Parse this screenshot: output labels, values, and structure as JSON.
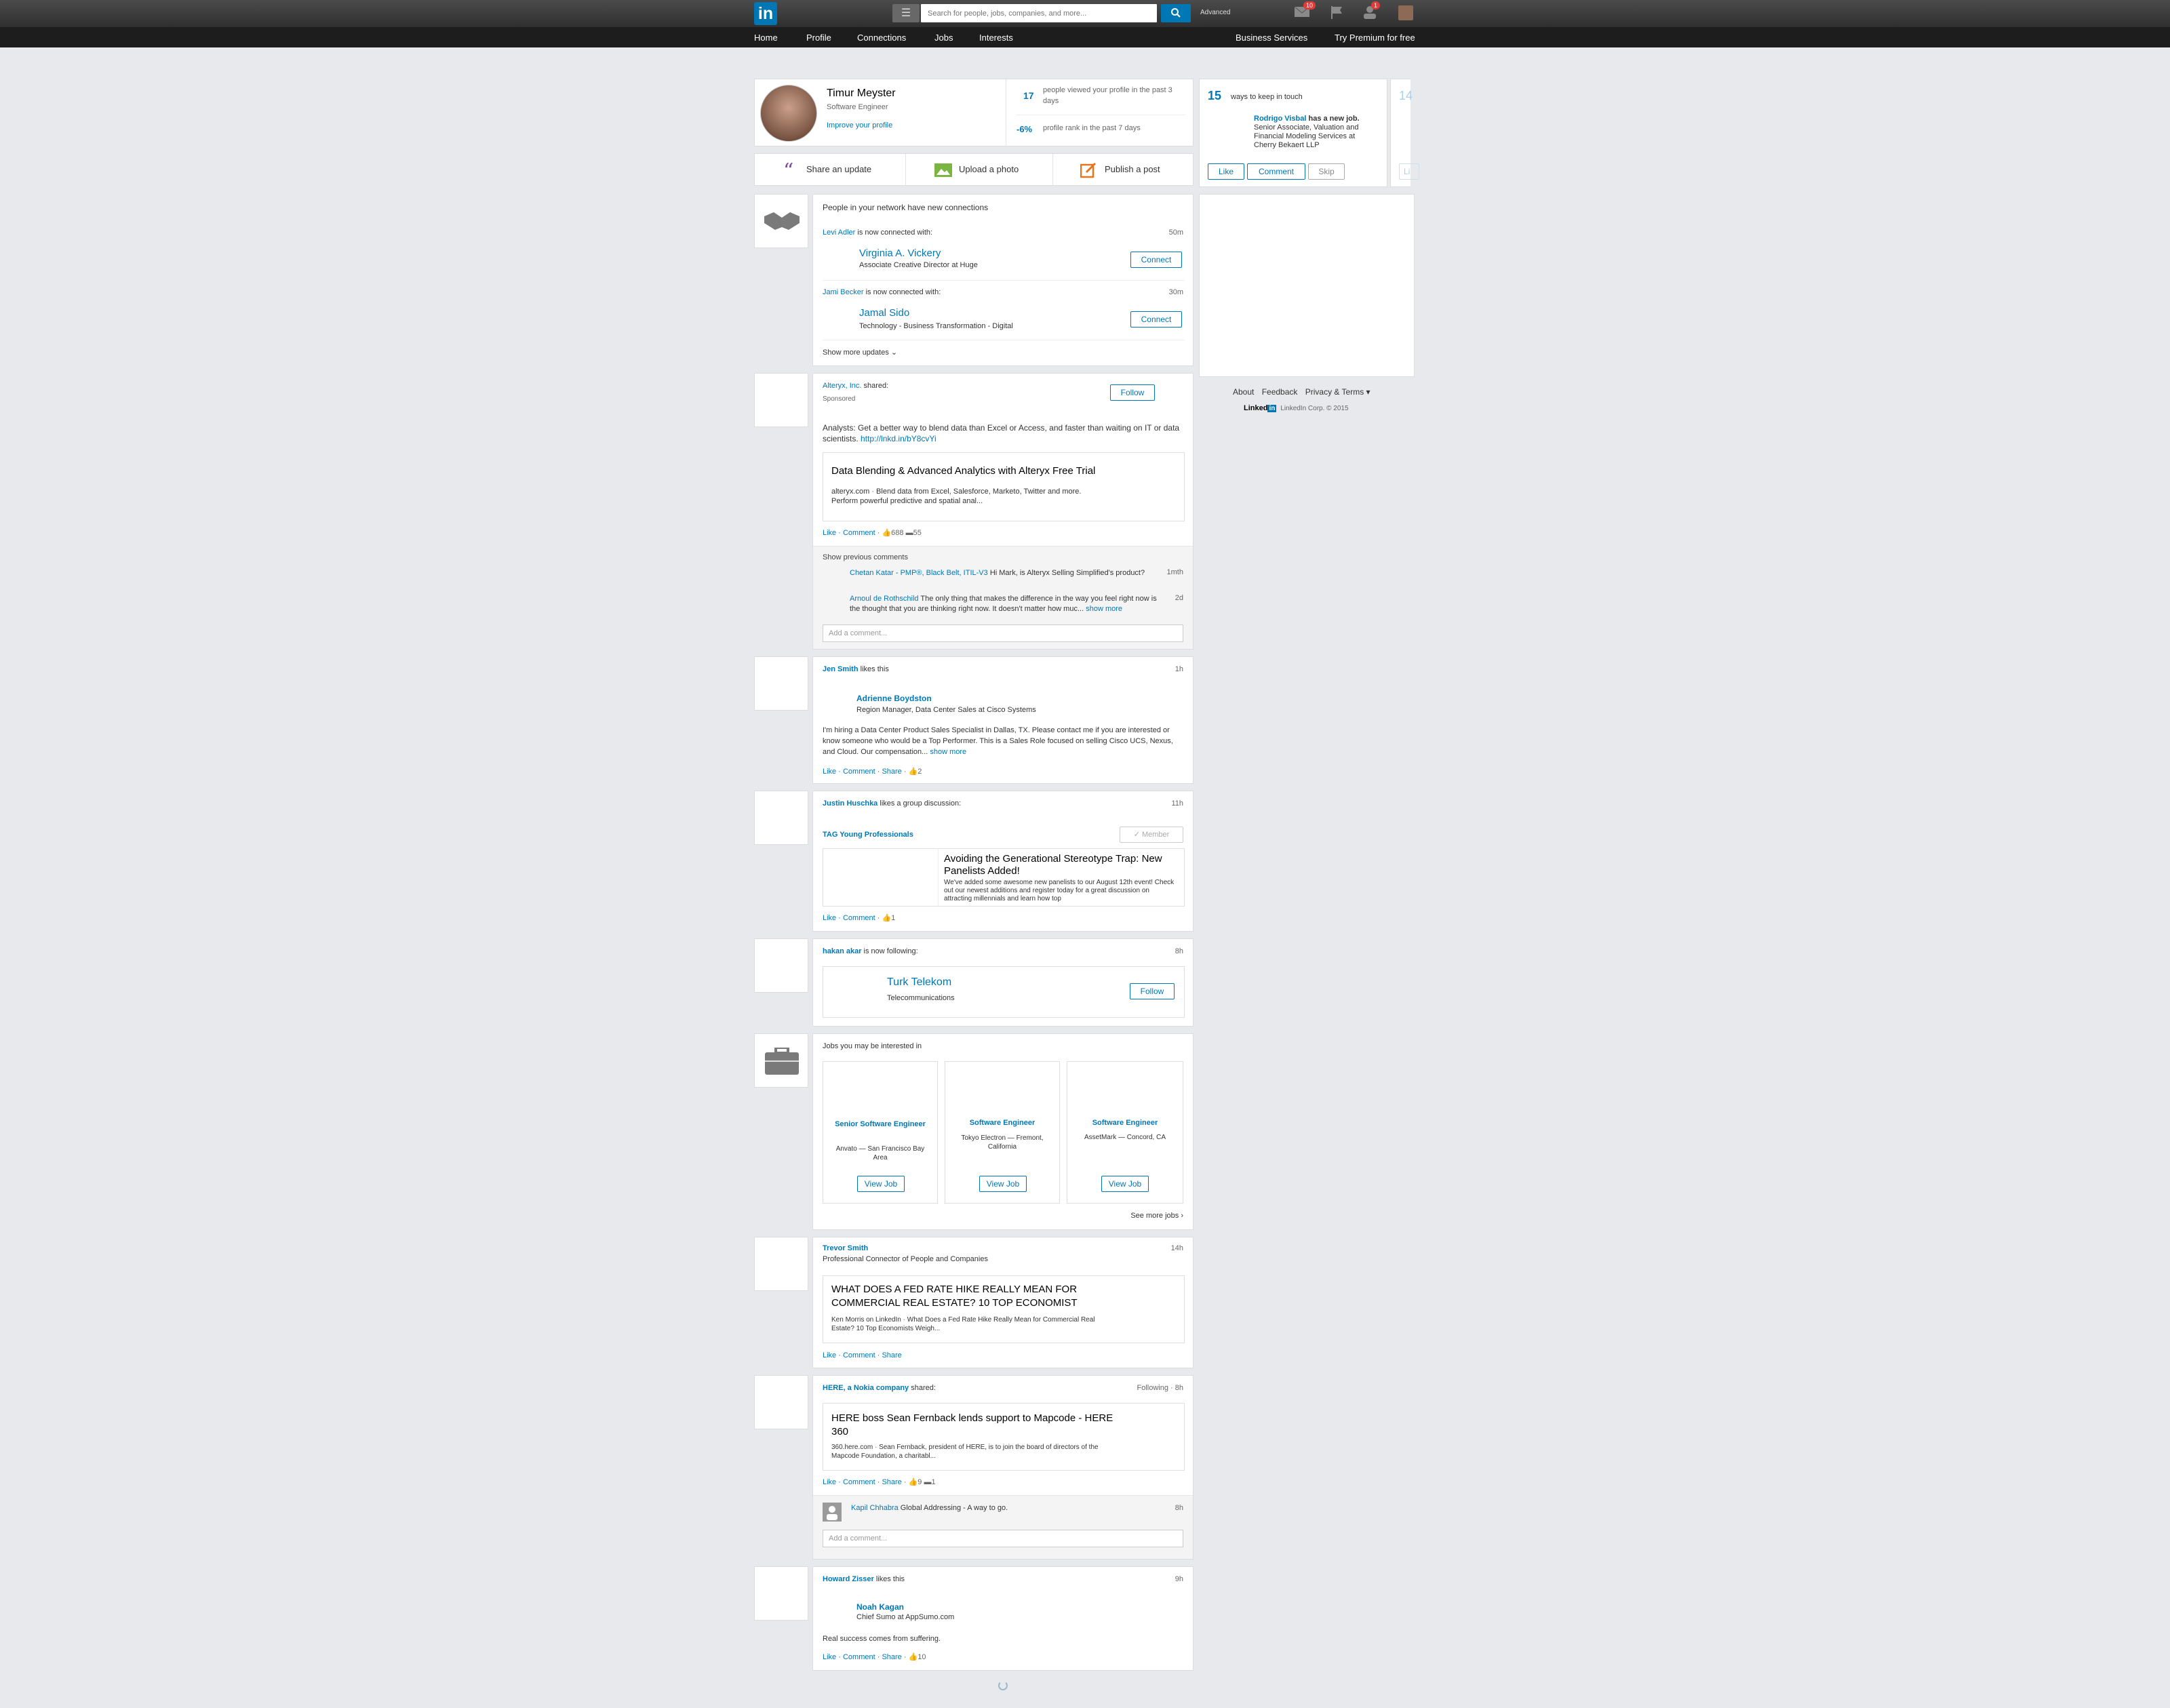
{
  "nav": {
    "logo": "in",
    "search_placeholder": "Search for people, jobs, companies, and more...",
    "advanced": "Advanced",
    "messages_badge": "10",
    "notifications_badge": "1",
    "items": [
      "Home",
      "Profile",
      "Connections",
      "Jobs",
      "Interests"
    ],
    "business": "Business Services",
    "premium": "Try Premium for free"
  },
  "profile": {
    "name": "Timur Meyster",
    "title": "Software Engineer",
    "improve": "Improve your profile",
    "views_count": "17",
    "views_text": "people viewed your profile in the past 3 days",
    "rank": "-6%",
    "rank_text": "profile rank in the past 7 days"
  },
  "share": {
    "update": "Share an update",
    "photo": "Upload a photo",
    "post": "Publish a post"
  },
  "right": {
    "count": "15",
    "ways": "ways to keep in touch",
    "next_count": "14",
    "person": "Rodrigo Visbal",
    "has_job": "has a new job.",
    "job_desc": "Senior Associate, Valuation and Financial Modeling Services at Cherry Bekaert LLP",
    "like": "Like",
    "comment": "Comment",
    "skip": "Skip",
    "peek": "Li",
    "footer": {
      "about": "About",
      "feedback": "Feedback",
      "privacy": "Privacy & Terms",
      "brand": "Linked",
      "copyright": "LinkedIn Corp. © 2015"
    }
  },
  "feed": {
    "net": {
      "header": "People in your network have new connections",
      "c1": {
        "who": "Levi Adler",
        "text": "is now connected with:",
        "time": "50m",
        "name": "Virginia A. Vickery",
        "desc": "Associate Creative Director at Huge",
        "btn": "Connect"
      },
      "c2": {
        "who": "Jami Becker",
        "text": "is now connected with:",
        "time": "30m",
        "name": "Jamal Sido",
        "desc": "Technology - Business Transformation - Digital",
        "btn": "Connect"
      },
      "more": "Show more updates"
    },
    "alteryx": {
      "company": "Alteryx, Inc.",
      "shared": "shared:",
      "sponsored": "Sponsored",
      "follow": "Follow",
      "text": "Analysts: Get a better way to blend data than Excel or Access, and faster than waiting on IT or data scientists.",
      "link": "http://lnkd.in/bY8cvYi",
      "card_title": "Data Blending & Advanced Analytics with Alteryx Free Trial",
      "card_src": "alteryx.com",
      "card_desc1": "Blend data from Excel, Salesforce, Marketo, Twitter and more.",
      "card_desc2": "Perform powerful predictive and spatial anal...",
      "like": "Like",
      "comment": "Comment",
      "likes": "688",
      "comments": "55",
      "prev": "Show previous comments",
      "cm1_who": "Chetan Katar - PMP®, Black Belt, ITIL-V3",
      "cm1_text": "Hi Mark, is Alteryx Selling Simplified's product?",
      "cm1_time": "1mth",
      "cm2_who": "Arnoul de Rothschild",
      "cm2_text": "The only thing that makes the difference in the way you feel right now is the thought that you are thinking right now. It doesn't matter how muc...",
      "cm2_more": "show more",
      "cm2_time": "2d",
      "add": "Add a comment..."
    },
    "jen": {
      "who": "Jen Smith",
      "text": "likes this",
      "time": "1h",
      "name": "Adrienne Boydston",
      "title": "Region Manager, Data Center Sales at Cisco Systems",
      "body": "I'm hiring a Data Center Product Sales Specialist in Dallas, TX. Please contact me if you are interested or know someone who would be a Top Performer. This is a Sales Role focused on selling Cisco UCS, Nexus, and Cloud. Our compensation...",
      "more": "show more",
      "like": "Like",
      "comment": "Comment",
      "share": "Share",
      "likes": "2"
    },
    "justin": {
      "who": "Justin Huschka",
      "text": "likes a group discussion:",
      "time": "11h",
      "group": "TAG Young Professionals",
      "member": "✓ Member",
      "title": "Avoiding the Generational Stereotype Trap: New Panelists Added!",
      "desc": "We've added some awesome new panelists to our August 12th event! Check out our newest additions and register today for a great discussion on attracting millennials and learn how top",
      "like": "Like",
      "comment": "Comment",
      "likes": "1"
    },
    "hakan": {
      "who": "hakan akar",
      "text": "is now following:",
      "time": "8h",
      "company": "Turk Telekom",
      "industry": "Telecommunications",
      "follow": "Follow"
    },
    "jobs": {
      "header": "Jobs you may be interested in",
      "see_more": "See more jobs ›",
      "items": [
        {
          "title": "Senior Software Engineer",
          "company": "Anvato — San Francisco Bay Area",
          "btn": "View Job"
        },
        {
          "title": "Software Engineer",
          "company": "Tokyo Electron — Fremont, California",
          "btn": "View Job"
        },
        {
          "title": "Software Engineer",
          "company": "AssetMark — Concord, CA",
          "btn": "View Job"
        }
      ]
    },
    "trevor": {
      "who": "Trevor Smith",
      "headline": "Professional Connector of People and Companies",
      "time": "14h",
      "title": "WHAT DOES A FED RATE HIKE REALLY MEAN FOR COMMERCIAL REAL ESTATE? 10 TOP ECONOMIST",
      "src": "Ken Morris on LinkedIn",
      "desc": "What Does a Fed Rate Hike Really Mean for Commercial Real Estate? 10 Top Economists Weigh...",
      "like": "Like",
      "comment": "Comment",
      "share": "Share"
    },
    "here": {
      "who": "HERE, a Nokia company",
      "shared": "shared:",
      "following": "Following",
      "time": "8h",
      "title": "HERE boss Sean Fernback lends support to Mapcode - HERE 360",
      "src": "360.here.com",
      "desc": "Sean Fernback, president of HERE, is to join the board of directors of the Mapcode Foundation, a charitabl...",
      "like": "Like",
      "comment": "Comment",
      "share": "Share",
      "likes": "9",
      "comments": "1",
      "cm_who": "Kapil Chhabra",
      "cm_text": "Global Addressing - A way to go.",
      "cm_time": "8h",
      "add": "Add a comment..."
    },
    "howard": {
      "who": "Howard Zisser",
      "text": "likes this",
      "time": "9h",
      "name": "Noah Kagan",
      "title": "Chief Sumo at AppSumo.com",
      "body": "Real success comes from suffering.",
      "like": "Like",
      "comment": "Comment",
      "share": "Share",
      "likes": "10"
    }
  },
  "colors": {
    "brand": "#0077b5",
    "page_bg": "#e7e9ec",
    "topbar": "#3a3a3a"
  }
}
